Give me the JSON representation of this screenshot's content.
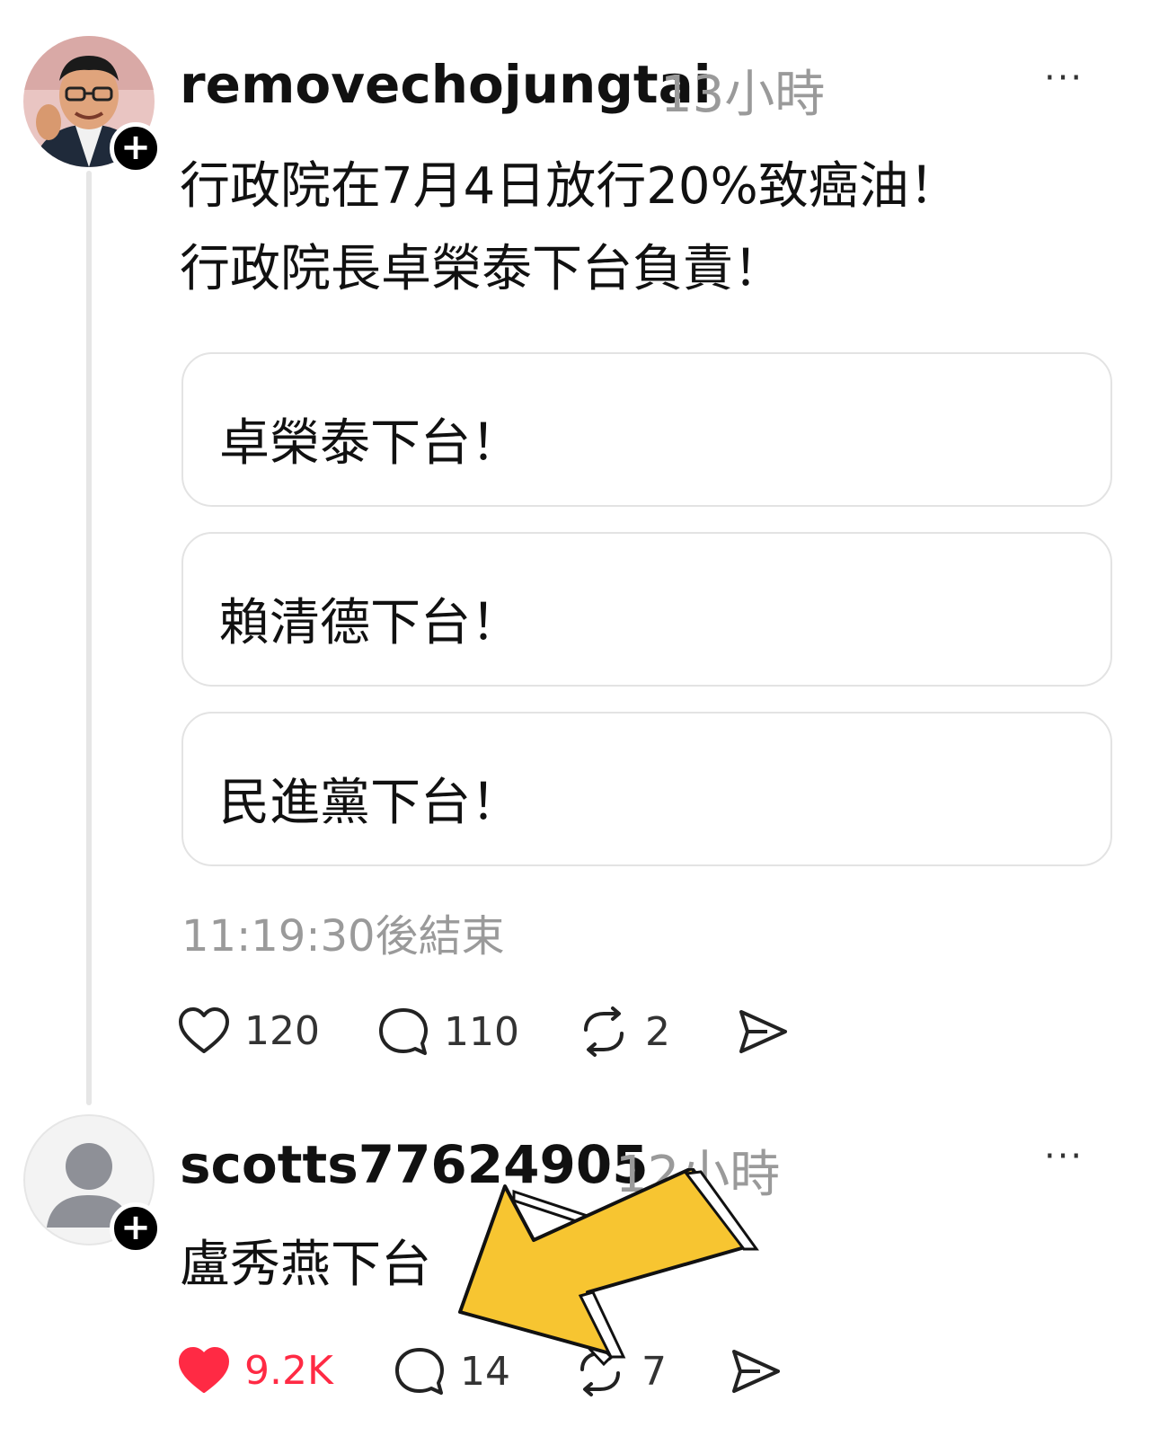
{
  "post1": {
    "username": "removechojungtai",
    "time": "13小時",
    "more": "···",
    "follow_icon": "+",
    "text_line1": "行政院在7月4日放行20%致癌油！",
    "text_line2": "行政院長卓榮泰下台負責！",
    "poll": {
      "options": [
        {
          "label": "卓榮泰下台！"
        },
        {
          "label": "賴清德下台！"
        },
        {
          "label": "民進黨下台！"
        }
      ],
      "status": "11:19:30後結束"
    },
    "actions": {
      "likes": "120",
      "comments": "110",
      "reposts": "2"
    }
  },
  "post2": {
    "username": "scotts77624905",
    "time": "12小時",
    "more": "···",
    "follow_icon": "+",
    "text": "盧秀燕下台",
    "actions": {
      "likes": "9.2K",
      "comments": "14",
      "reposts": "7",
      "liked": true
    }
  },
  "colors": {
    "like_active": "#ff2a44",
    "arrow_fill": "#f7c531",
    "muted_text": "#9a9a9a"
  },
  "icons": [
    "heart-icon",
    "comment-icon",
    "repost-icon",
    "share-icon",
    "more-icon",
    "follow-plus-icon",
    "default-avatar-icon",
    "pointer-arrow-icon"
  ]
}
